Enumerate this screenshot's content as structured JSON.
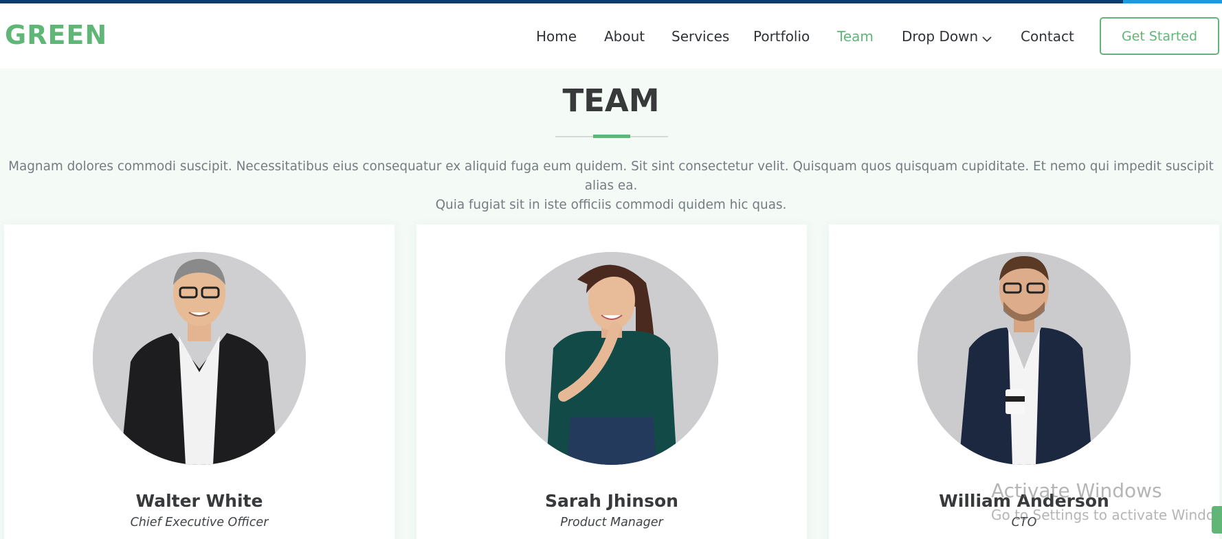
{
  "brand": {
    "logo": "GREEN",
    "accent_color": "#5fb677"
  },
  "nav": {
    "items": [
      {
        "label": "Home"
      },
      {
        "label": "About"
      },
      {
        "label": "Services"
      },
      {
        "label": "Portfolio"
      },
      {
        "label": "Team",
        "active": true
      },
      {
        "label": "Drop Down",
        "icon": "chevron-down-icon"
      },
      {
        "label": "Contact"
      }
    ],
    "cta_label": "Get Started"
  },
  "team": {
    "title": "TEAM",
    "description_line1": "Magnam dolores commodi suscipit. Necessitatibus eius consequatur ex aliquid fuga eum quidem. Sit sint consectetur velit. Quisquam quos quisquam cupiditate. Et nemo qui impedit suscipit alias ea.",
    "description_line2": "Quia fugiat sit in iste officiis commodi quidem hic quas.",
    "members": [
      {
        "name": "Walter White",
        "role": "Chief Executive Officer"
      },
      {
        "name": "Sarah Jhinson",
        "role": "Product Manager"
      },
      {
        "name": "William Anderson",
        "role": "CTO"
      }
    ]
  },
  "os_watermark": {
    "line1": "Activate Windows",
    "line2": "Go to Settings to activate Windows."
  }
}
